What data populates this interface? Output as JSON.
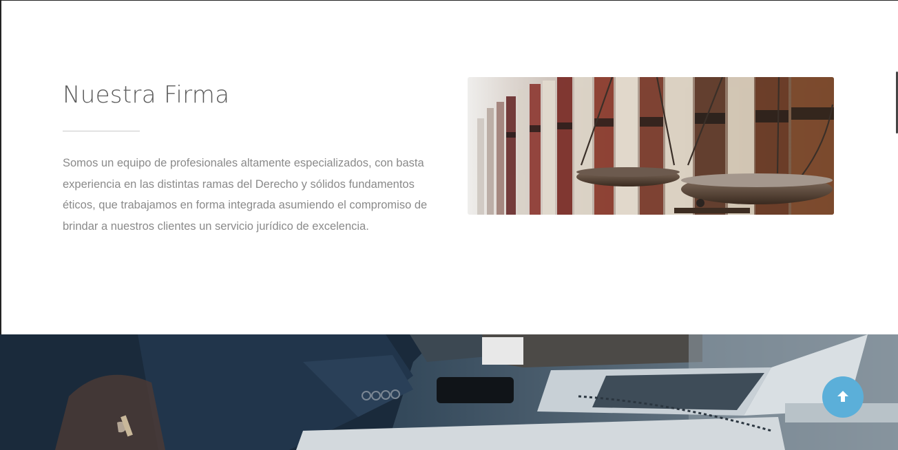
{
  "firm": {
    "title": "Nuestra Firma",
    "description": "Somos un equipo de profesionales altamente especializados, con basta experiencia en las distintas ramas del Derecho y sólidos fundamentos éticos, que trabajamos en forma integrada asumiendo el compromiso de brindar a nuestros clientes un servicio jurídico de excelencia."
  },
  "images": {
    "firm_photo": "scales-of-justice-books",
    "hero_photo": "businessman-laptop-desk"
  },
  "scroll_top": {
    "icon": "arrow-up-icon"
  },
  "colors": {
    "accent": "#5bafd9",
    "title_text": "#5a5a5a",
    "body_text": "#8a8a8a",
    "hero_overlay": "#1f3447"
  }
}
